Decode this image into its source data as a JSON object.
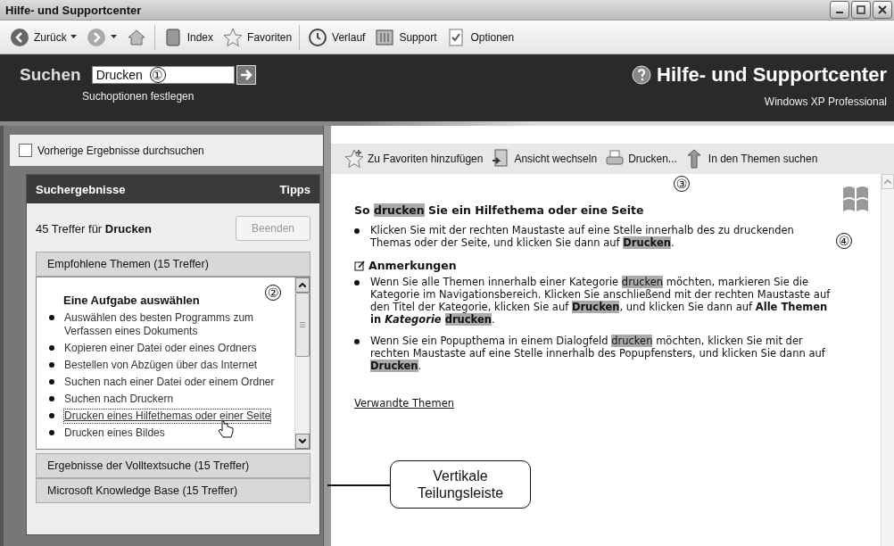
{
  "window": {
    "title": "Hilfe- und Supportcenter"
  },
  "toolbar": [
    {
      "kind": "back",
      "label": "Zurück",
      "dropdown": true
    },
    {
      "kind": "forward",
      "dropdown": true
    },
    {
      "kind": "home"
    },
    {
      "kind": "index",
      "label": "Index"
    },
    {
      "kind": "favorites",
      "label": "Favoriten"
    },
    {
      "kind": "history",
      "label": "Verlauf"
    },
    {
      "kind": "support",
      "label": "Support"
    },
    {
      "kind": "options",
      "label": "Optionen"
    }
  ],
  "search": {
    "label": "Suchen",
    "value": "Drucken",
    "callout": "①",
    "options_link": "Suchoptionen festlegen"
  },
  "brand": {
    "title": "Hilfe- und Supportcenter",
    "subtitle": "Windows XP Professional"
  },
  "previous_results": {
    "label": "Vorherige Ergebnisse durchsuchen",
    "checked": false
  },
  "results": {
    "title": "Suchergebnisse",
    "tips": "Tipps",
    "count": "45 Treffer für **Drucken**",
    "stop_button": {
      "label": "Beenden",
      "disabled": true
    },
    "sections": [
      {
        "title": "Empfohlene Themen (15 Treffer)",
        "expanded": true,
        "callout": "②",
        "heading": "Eine Aufgabe auswählen",
        "items": [
          {
            "label": "Auswählen des besten Programms zum Verfassen eines Dokuments",
            "selected": false
          },
          {
            "label": "Kopieren einer Datei oder eines Ordners",
            "selected": false
          },
          {
            "label": "Bestellen von Abzügen über das Internet",
            "selected": false
          },
          {
            "label": "Suchen nach einer Datei oder einem Ordner",
            "selected": false
          },
          {
            "label": "Suchen nach Druckern",
            "selected": false
          },
          {
            "label": "Drucken eines Hilfethemas oder einer Seite",
            "selected": true
          },
          {
            "label": "Drucken eines Bildes",
            "selected": false
          }
        ]
      },
      {
        "title": "Ergebnisse der Volltextsuche (15 Treffer)",
        "expanded": false
      },
      {
        "title": "Microsoft Knowledge Base (15 Treffer)",
        "expanded": false
      }
    ]
  },
  "article_toolbar": [
    {
      "kind": "add-favorite",
      "label": "Zu Favoriten hinzufügen"
    },
    {
      "kind": "switch-view",
      "label": "Ansicht wechseln"
    },
    {
      "kind": "print",
      "label": "Drucken..."
    },
    {
      "kind": "locate",
      "label": "In den Themen suchen"
    }
  ],
  "article": {
    "callout": "③",
    "title": [
      {
        "text": "So "
      },
      {
        "text": "drucken",
        "highlight": true
      },
      {
        "text": " Sie ein Hilfethema oder eine Seite"
      }
    ],
    "steps": [
      {
        "callout": "④",
        "segments": [
          {
            "text": "Klicken Sie mit der rechten Maustaste auf eine Stelle innerhalb des zu druckenden Themas oder der Seite, und klicken Sie dann auf "
          },
          {
            "text": "Drucken",
            "bold": true,
            "highlight": true
          },
          {
            "text": "."
          }
        ]
      }
    ],
    "notes_heading": "Anmerkungen",
    "notes": [
      {
        "segments": [
          {
            "text": "Wenn Sie alle Themen innerhalb einer Kategorie "
          },
          {
            "text": "drucken",
            "highlight": true
          },
          {
            "text": " möchten, markieren Sie die Kategorie im Navigationsbereich. Klicken Sie anschließend mit der rechten Maustaste auf den Titel der Kategorie, klicken Sie auf "
          },
          {
            "text": "Drucken",
            "bold": true,
            "highlight": true
          },
          {
            "text": ", und klicken Sie dann auf "
          },
          {
            "text": "Alle Themen in ",
            "bold": true
          },
          {
            "text": "Kategorie ",
            "bold": true,
            "italic": true
          },
          {
            "text": "drucken",
            "bold": true,
            "highlight": true
          },
          {
            "text": "."
          }
        ]
      },
      {
        "segments": [
          {
            "text": "Wenn Sie ein Popupthema in einem Dialogfeld "
          },
          {
            "text": "drucken",
            "highlight": true
          },
          {
            "text": " möchten, klicken Sie mit der rechten Maustaste auf eine Stelle innerhalb des Popupfensters, und klicken Sie dann auf "
          },
          {
            "text": "Drucken",
            "bold": true,
            "highlight": true
          },
          {
            "text": "."
          }
        ]
      }
    ],
    "related_link": "Verwandte Themen"
  },
  "annotation": {
    "text": "Vertikale Teilungsleiste"
  }
}
